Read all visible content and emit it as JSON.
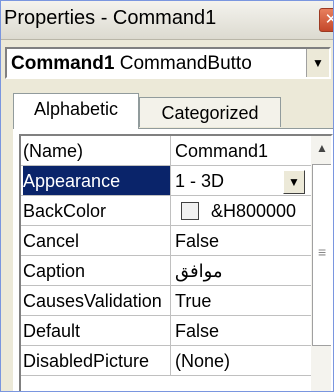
{
  "window": {
    "title": "Properties - Command1",
    "close_glyph": "✕"
  },
  "object_selector": {
    "name": "Command1",
    "type": "CommandButto",
    "arrow_glyph": "▼"
  },
  "tabs": [
    {
      "label": "Alphabetic",
      "active": true
    },
    {
      "label": "Categorized",
      "active": false
    }
  ],
  "properties": [
    {
      "name": "(Name)",
      "value": "Command1"
    },
    {
      "name": "Appearance",
      "value": "1 - 3D",
      "selected": true,
      "dropdown_glyph": "▼"
    },
    {
      "name": "BackColor",
      "value": "&H800000",
      "swatch": "#f0f0f0"
    },
    {
      "name": "Cancel",
      "value": "False"
    },
    {
      "name": "Caption",
      "value": "موافق"
    },
    {
      "name": "CausesValidation",
      "value": "True"
    },
    {
      "name": "Default",
      "value": "False"
    },
    {
      "name": "DisabledPicture",
      "value": "(None)"
    }
  ],
  "scrollbar": {
    "up_glyph": "▲",
    "grip_glyph": "≡"
  },
  "colors": {
    "selection": "#0a246a",
    "panel": "#ece9d8"
  }
}
